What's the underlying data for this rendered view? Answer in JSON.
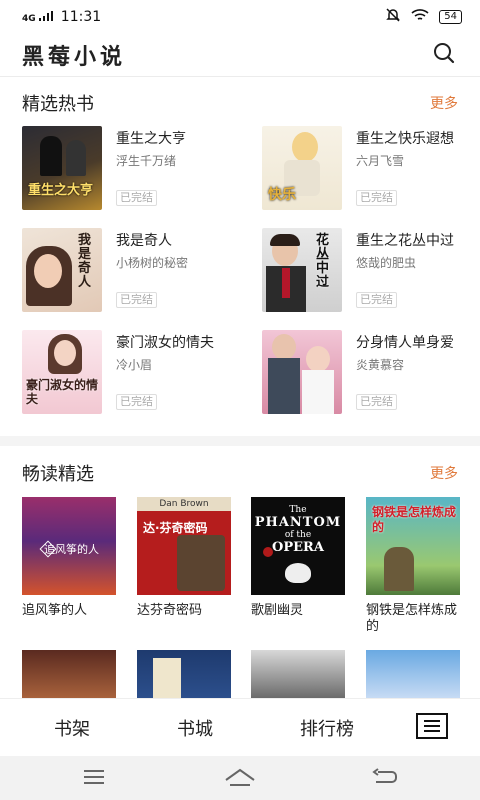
{
  "status": {
    "network": "4G",
    "time": "11:31",
    "battery": "54"
  },
  "app": {
    "title": "黑莓小说"
  },
  "section1": {
    "title": "精选热书",
    "more": "更多",
    "books": [
      {
        "title": "重生之大亨",
        "author": "浮生千万绪",
        "status": "已完结",
        "cover_text": "重生之大亨"
      },
      {
        "title": "重生之快乐遐想",
        "author": "六月飞雪",
        "status": "已完结",
        "cover_text": "快乐"
      },
      {
        "title": "我是奇人",
        "author": "小杨树的秘密",
        "status": "已完结",
        "cover_text": "我是奇人"
      },
      {
        "title": "重生之花丛中过",
        "author": "悠哉的肥虫",
        "status": "已完结",
        "cover_text": "花丛中过"
      },
      {
        "title": "豪门淑女的情夫",
        "author": "冷小眉",
        "status": "已完结",
        "cover_text": "豪门淑女的情夫"
      },
      {
        "title": "分身情人单身爱",
        "author": "炎黄慕容",
        "status": "已完结",
        "cover_text": ""
      }
    ]
  },
  "section2": {
    "title": "畅读精选",
    "more": "更多",
    "books": [
      {
        "title": "追风筝的人",
        "cover_text": "追风筝的人"
      },
      {
        "title": "达芬奇密码",
        "cover_text": "达·芬奇密码",
        "cover_author": "Dan Brown"
      },
      {
        "title": "歌剧幽灵",
        "cover_text": "PHANTOM",
        "cover_sub": "of the",
        "cover_end": "OPERA",
        "cover_top": "The"
      },
      {
        "title": "钢铁是怎样炼成的",
        "cover_text": "钢铁是怎样炼成的"
      }
    ]
  },
  "tabs": {
    "shelf": "书架",
    "store": "书城",
    "rank": "排行榜"
  },
  "icons": {
    "search": "search-icon",
    "menu": "menu-icon"
  },
  "colors": {
    "accent": "#e07a3c"
  }
}
